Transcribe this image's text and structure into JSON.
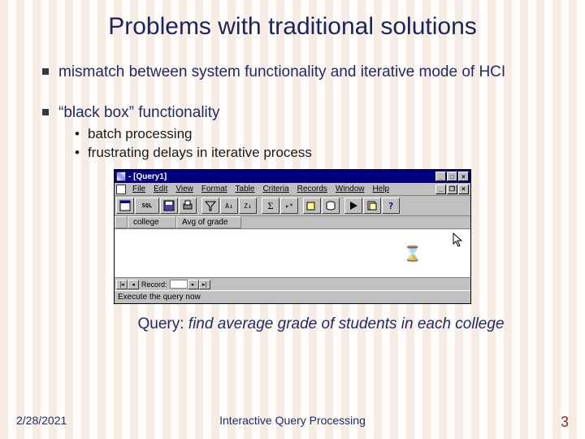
{
  "slide": {
    "title": "Problems with traditional solutions",
    "bullets": [
      {
        "text": "mismatch between system functionality and iterative mode of HCI",
        "sub": []
      },
      {
        "text": "“black box” functionality",
        "sub": [
          "batch processing",
          "frustrating delays in iterative process"
        ]
      }
    ],
    "query_label": "Query: ",
    "query_text": "find average grade of students in each college"
  },
  "app": {
    "titlebar": "- [Query1]",
    "menus": [
      "File",
      "Edit",
      "View",
      "Format",
      "Table",
      "Criteria",
      "Records",
      "Window",
      "Help"
    ],
    "columns": [
      "college",
      "Avg of grade"
    ],
    "record_label": "Record:",
    "status": "Execute the query now"
  },
  "footer": {
    "date": "2/28/2021",
    "center": "Interactive Query Processing",
    "page": "3"
  }
}
